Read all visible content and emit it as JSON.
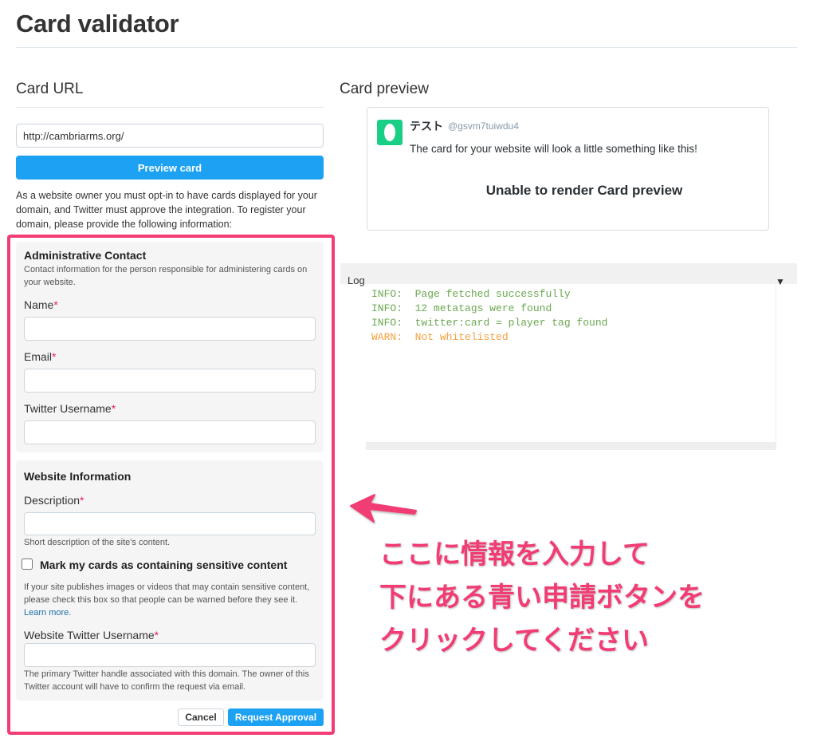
{
  "page": {
    "title": "Card validator"
  },
  "card_url": {
    "heading": "Card URL",
    "url_value": "http://cambriarms.org/",
    "preview_button": "Preview card",
    "intro": "As a website owner you must opt-in to have cards displayed for your domain, and Twitter must approve the integration. To register your domain, please provide the following information:"
  },
  "admin_contact": {
    "title": "Administrative Contact",
    "help": "Contact information for the person responsible for administering cards on your website.",
    "name_label": "Name",
    "email_label": "Email",
    "twitter_label": "Twitter Username",
    "required_mark": "*"
  },
  "website_info": {
    "title": "Website Information",
    "description_label": "Description",
    "description_help": "Short description of the site's content.",
    "sensitive_label": "Mark my cards as containing sensitive content",
    "sensitive_help": "If your site publishes images or videos that may contain sensitive content, please check this box so that people can be warned before they see it.",
    "learn_more": "Learn more.",
    "site_twitter_label": "Website Twitter Username",
    "site_twitter_help": "The primary Twitter handle associated with this domain. The owner of this Twitter account will have to confirm the request via email."
  },
  "actions": {
    "cancel": "Cancel",
    "request": "Request Approval"
  },
  "card_preview": {
    "heading": "Card preview",
    "name": "テスト",
    "handle": "@gsvm7tuiwdu4",
    "text": "The card for your website will look a little something like this!",
    "render_message": "Unable to render Card preview"
  },
  "log": {
    "label": "Log",
    "toggle_icon": "▼",
    "lines": [
      {
        "level": "INFO:",
        "message": "Page fetched successfully",
        "color": "#6aa84f"
      },
      {
        "level": "INFO:",
        "message": "12 metatags were found",
        "color": "#6aa84f"
      },
      {
        "level": "INFO:",
        "message": "twitter:card = player tag found",
        "color": "#6aa84f"
      },
      {
        "level": "WARN:",
        "message": "Not whitelisted",
        "color": "#f6a03d"
      }
    ]
  },
  "annotation": {
    "line1": "ここに情報を入力して",
    "line2": "下にある青い申請ボタンを",
    "line3": "クリックしてください",
    "color": "#f23c74"
  }
}
